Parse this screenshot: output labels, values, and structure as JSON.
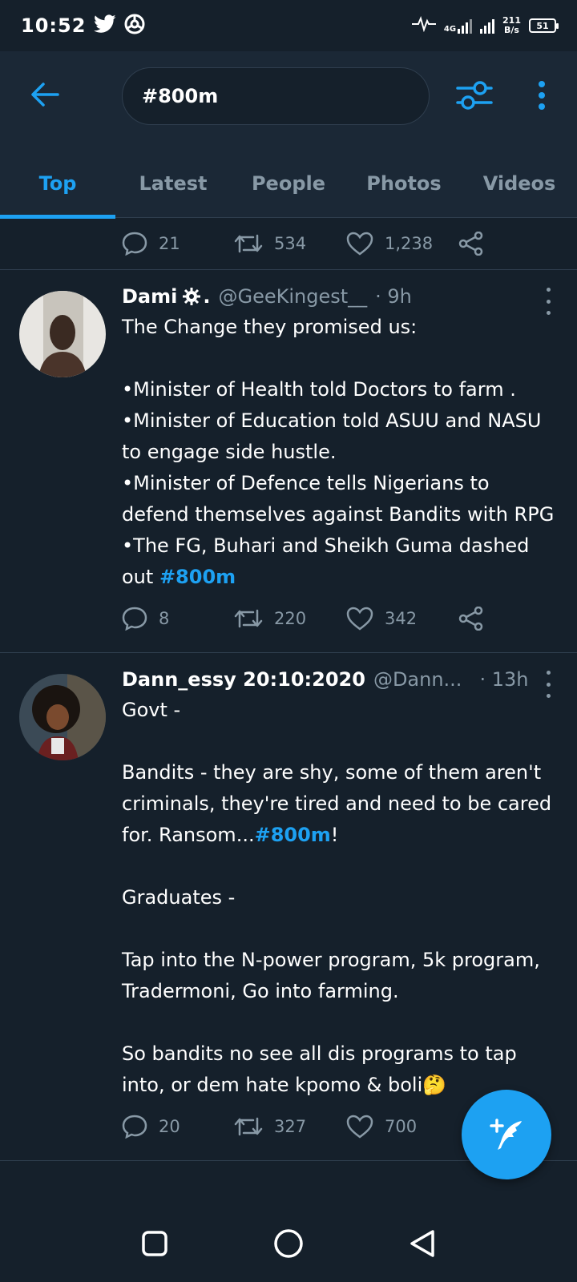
{
  "status_bar": {
    "time": "10:52",
    "network": "4G",
    "speed_value": "211",
    "speed_unit": "B/s",
    "battery": "51"
  },
  "search": {
    "query": "#800m"
  },
  "tabs": [
    {
      "label": "Top",
      "active": true
    },
    {
      "label": "Latest",
      "active": false
    },
    {
      "label": "People",
      "active": false
    },
    {
      "label": "Photos",
      "active": false
    },
    {
      "label": "Videos",
      "active": false
    }
  ],
  "prev_tweet_actions": {
    "replies": "21",
    "retweets": "534",
    "likes": "1,238"
  },
  "tweets": [
    {
      "name": "Dami",
      "handle": "@GeeKingest__",
      "time": "· 9h",
      "body_text": "The Change they promised us:\n\n•Minister of Health told Doctors to farm .\n•Minister of Education told ASUU and NASU to engage side hustle.\n•Minister of Defence tells Nigerians to defend themselves against Bandits with RPG\n•The FG, Buhari and Sheikh Guma dashed out ",
      "hashtag": "#800m",
      "replies": "8",
      "retweets": "220",
      "likes": "342"
    },
    {
      "name": "Dann_essy 20:10:2020",
      "handle": "@Dann...",
      "time": "· 13h",
      "body_part1": "Govt -\n\nBandits - they are shy, some of them aren't criminals, they're tired and need to be cared for. Ransom...",
      "hashtag": "#800m",
      "body_part2": "!\n\nGraduates -\n\nTap into the N-power program, 5k program, Tradermoni, Go into farming.\n\nSo bandits no see all dis programs to tap into, or dem hate kpomo & boli🤔",
      "replies": "20",
      "retweets": "327",
      "likes": "700"
    }
  ],
  "colors": {
    "background": "#15202b",
    "header": "#1b2836",
    "accent": "#1da1f2",
    "muted": "#8899a6"
  }
}
